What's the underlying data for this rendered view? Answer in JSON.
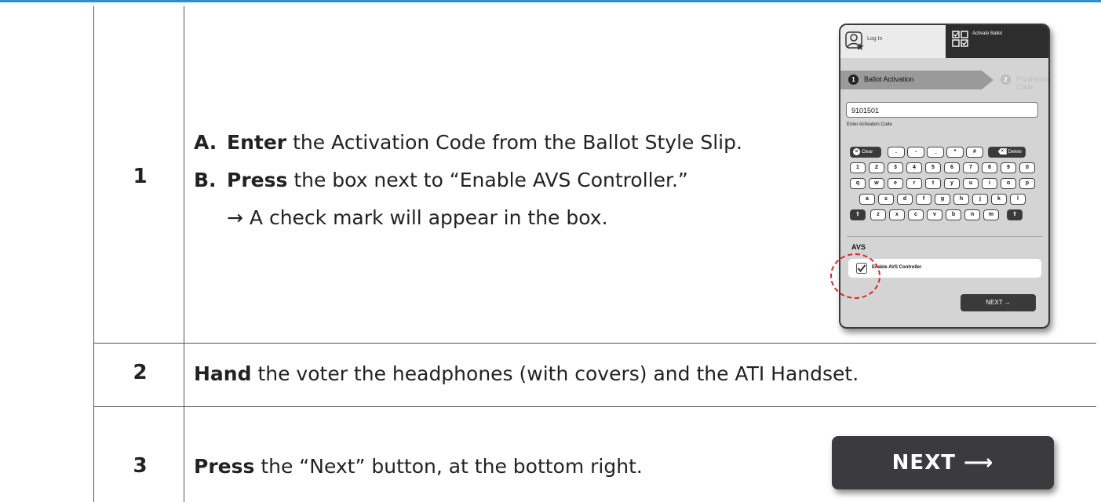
{
  "rows": [
    {
      "number": "1",
      "items": [
        {
          "letter": "A.",
          "verb": "Enter",
          "text": " the Activation Code from the Ballot Style Slip."
        },
        {
          "letter": "B.",
          "verb": "Press",
          "text": " the box next to “Enable AVS Controller.”"
        }
      ],
      "result": "→  A check mark will appear in the box."
    },
    {
      "number": "2",
      "verb": "Hand",
      "text": " the voter the headphones (with covers) and the ATI Handset."
    },
    {
      "number": "3",
      "verb": "Press",
      "text": " the “Next” button, at the bottom right."
    }
  ],
  "tablet": {
    "login_label": "Log In",
    "activate_label": "Activate Ballot",
    "step1_number": "1",
    "step1_label": "Ballot Activation",
    "step2_number": "2",
    "step2_label": "Provisional Code",
    "code_value": "9101501",
    "code_help": "Enter Activation Code",
    "clear_label": "Clear",
    "delete_label": "Delete",
    "symbol_keys": [
      ".",
      "-",
      "_",
      "*",
      "#"
    ],
    "number_keys": [
      "1",
      "2",
      "3",
      "4",
      "5",
      "6",
      "7",
      "8",
      "9",
      "0"
    ],
    "row_q": [
      "q",
      "w",
      "e",
      "r",
      "t",
      "y",
      "u",
      "i",
      "o",
      "p"
    ],
    "row_a": [
      "a",
      "s",
      "d",
      "f",
      "g",
      "h",
      "j",
      "k",
      "l"
    ],
    "row_z": [
      "z",
      "x",
      "c",
      "v",
      "b",
      "n",
      "m"
    ],
    "shift_icon": "⇧",
    "avs_heading": "AVS",
    "avs_checkbox_label": "Enable AVS Controller",
    "avs_checked": true,
    "next_label": "NEXT →"
  },
  "big_next_label": "NEXT ⟶",
  "colors": {
    "accent_line": "#2a8fd6",
    "highlight_circle": "#d9262a",
    "button_dark": "#3b3b3f"
  }
}
